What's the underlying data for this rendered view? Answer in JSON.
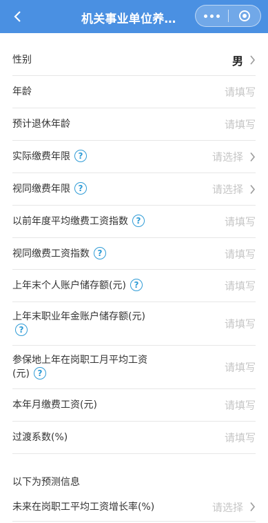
{
  "header": {
    "title": "机关事业单位养…",
    "more_icon": "more-dots-icon",
    "close_icon": "target-circle-icon"
  },
  "rows": [
    {
      "label": "性别",
      "value": "男",
      "filled": true,
      "chevron": true,
      "help": false
    },
    {
      "label": "年龄",
      "value": "请填写",
      "filled": false,
      "chevron": false,
      "help": false
    },
    {
      "label": "预计退休年龄",
      "value": "请填写",
      "filled": false,
      "chevron": false,
      "help": false
    },
    {
      "label": "实际缴费年限",
      "value": "请选择",
      "filled": false,
      "chevron": true,
      "help": true
    },
    {
      "label": "视同缴费年限",
      "value": "请选择",
      "filled": false,
      "chevron": true,
      "help": true
    },
    {
      "label": "以前年度平均缴费工资指数",
      "value": "请填写",
      "filled": false,
      "chevron": false,
      "help": true
    },
    {
      "label": "视同缴费工资指数",
      "value": "请填写",
      "filled": false,
      "chevron": false,
      "help": true
    },
    {
      "label": "上年末个人账户储存额(元)",
      "value": "请填写",
      "filled": false,
      "chevron": false,
      "help": true
    },
    {
      "label": "上年末职业年金账户储存额(元)",
      "value": "请填写",
      "filled": false,
      "chevron": false,
      "help": true
    },
    {
      "label": "参保地上年在岗职工月平均工资(元)",
      "value": "请填写",
      "filled": false,
      "chevron": false,
      "help": true
    },
    {
      "label": "本年月缴费工资(元)",
      "value": "请填写",
      "filled": false,
      "chevron": false,
      "help": false
    },
    {
      "label": "过渡系数(%)",
      "value": "请填写",
      "filled": false,
      "chevron": false,
      "help": false
    }
  ],
  "forecast": {
    "section_title": "以下为预测信息",
    "row": {
      "label": "未来在岗职工平均工资增长率(%)",
      "value": "请选择",
      "chevron": true
    }
  },
  "colors": {
    "header_bg": "#4a90e2",
    "help_icon": "#2e9bd6",
    "placeholder": "#c6c6c6"
  }
}
